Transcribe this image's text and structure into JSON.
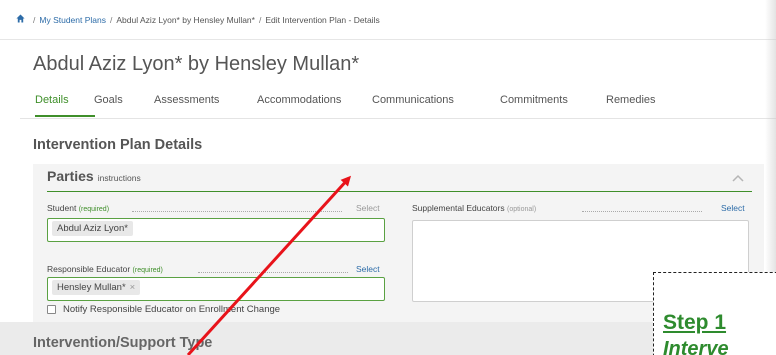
{
  "breadcrumb": {
    "home_icon": "home-icon",
    "items": [
      "My Student Plans",
      "Abdul Aziz Lyon* by Hensley Mullan*",
      "Edit Intervention Plan - Details"
    ],
    "separator": "/"
  },
  "page": {
    "title": "Abdul Aziz Lyon* by Hensley Mullan*"
  },
  "tabs": [
    {
      "label": "Details",
      "active": true
    },
    {
      "label": "Goals"
    },
    {
      "label": "Assessments"
    },
    {
      "label": "Accommodations"
    },
    {
      "label": "Communications"
    },
    {
      "label": "Commitments"
    },
    {
      "label": "Remedies"
    }
  ],
  "section": {
    "heading": "Intervention Plan Details"
  },
  "parties": {
    "title": "Parties",
    "instructions": "instructions",
    "student": {
      "label": "Student",
      "qualifier": "(required)",
      "select": "Select",
      "value": "Abdul Aziz Lyon*"
    },
    "supplemental": {
      "label": "Supplemental Educators",
      "qualifier": "(optional)",
      "select": "Select"
    },
    "responsible": {
      "label": "Responsible Educator",
      "qualifier": "(required)",
      "select": "Select",
      "value": "Hensley Mullan*",
      "remove": "×"
    },
    "notify_label": "Notify Responsible Educator on Enrollment Change"
  },
  "next_section": {
    "heading": "Intervention/Support Type"
  },
  "callout": {
    "step": "Step 1",
    "subtitle": "Interve"
  },
  "colors": {
    "accent_green": "#3f8f2a",
    "link_blue": "#2d6ca8",
    "arrow_red": "#e8131a",
    "callout_green": "#2e8b2e"
  }
}
